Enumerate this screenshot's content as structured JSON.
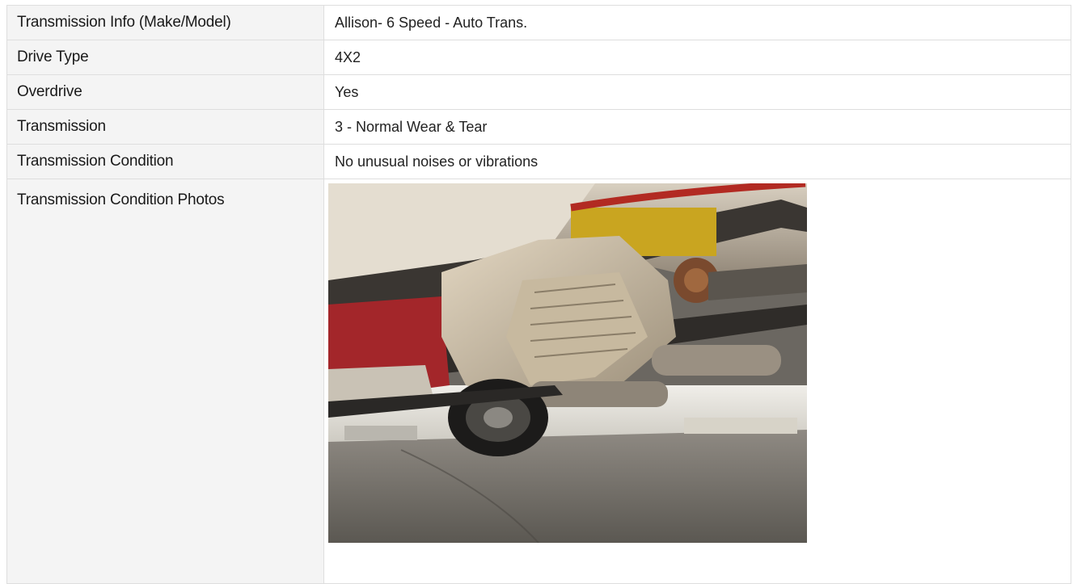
{
  "rows": [
    {
      "label": "Transmission Info (Make/Model)",
      "value": "Allison- 6 Speed - Auto Trans."
    },
    {
      "label": "Drive Type",
      "value": "4X2"
    },
    {
      "label": "Overdrive",
      "value": "Yes"
    },
    {
      "label": "Transmission",
      "value": "3 - Normal Wear & Tear"
    },
    {
      "label": "Transmission Condition",
      "value": "No unusual noises or vibrations"
    },
    {
      "label": "Transmission Condition Photos",
      "value": ""
    }
  ],
  "photo": {
    "icon": "transmission-undercarriage-photo"
  }
}
